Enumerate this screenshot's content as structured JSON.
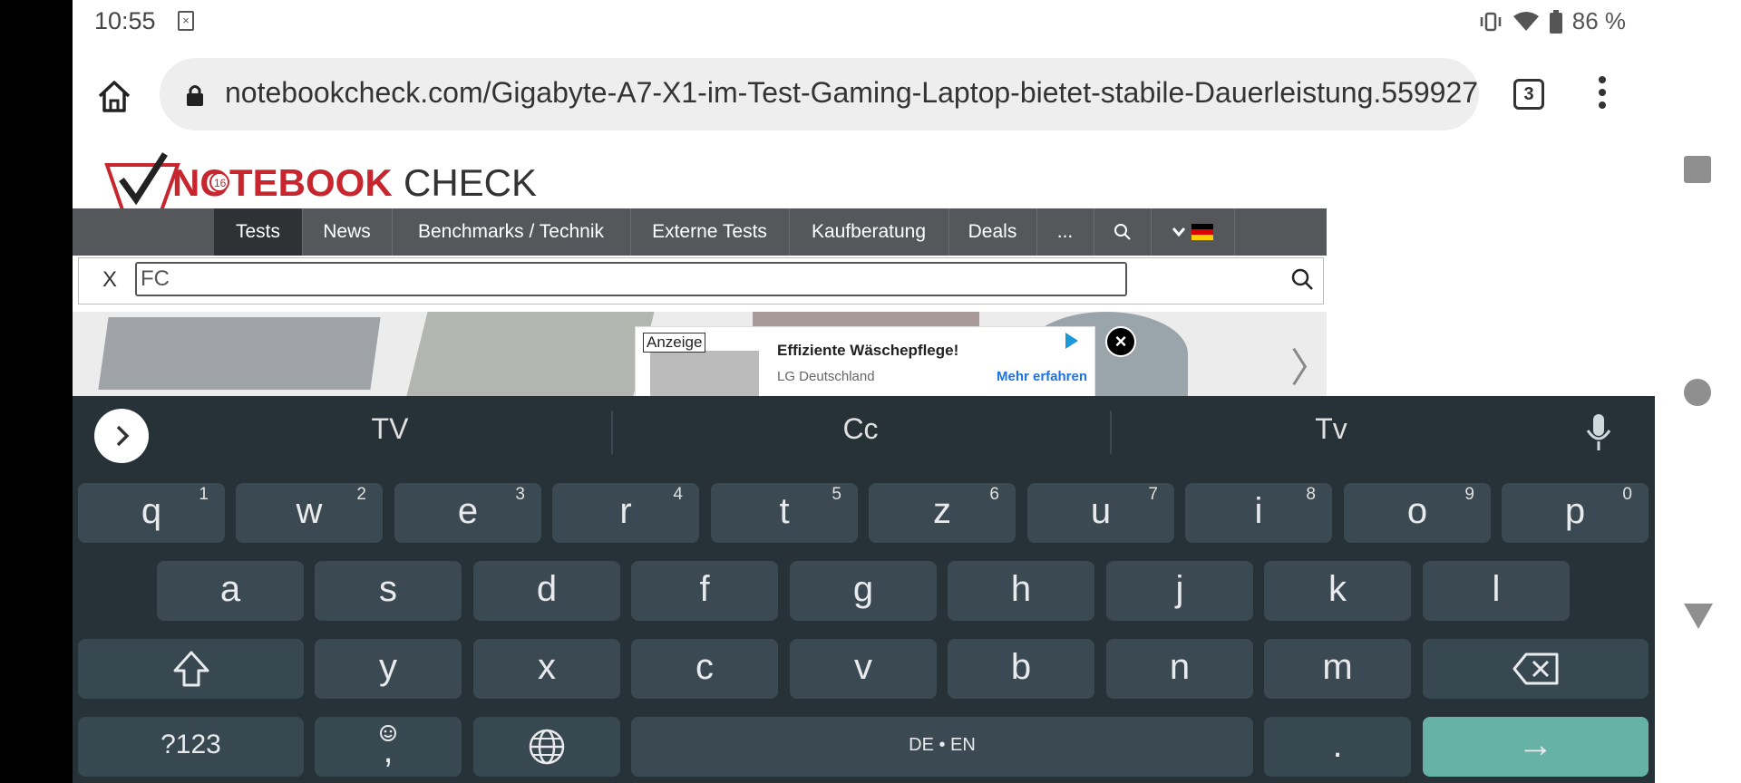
{
  "status_bar": {
    "time": "10:55",
    "battery": "86 %"
  },
  "browser": {
    "url": "notebookcheck.com/Gigabyte-A7-X1-im-Test-Gaming-Laptop-bietet-stabile-Dauerleistung.559927",
    "tab_count": "3"
  },
  "site": {
    "logo_text_red": "NOTEBOOK",
    "logo_text_dark": "CHECK",
    "logo_badge": "16",
    "nav": [
      "Tests",
      "News",
      "Benchmarks / Technik",
      "Externe Tests",
      "Kaufberatung",
      "Deals",
      "..."
    ],
    "search_close": "X",
    "search_value": "FC"
  },
  "ad": {
    "tag": "Anzeige",
    "title": "Effiziente Wäschepflege!",
    "advertiser": "LG Deutschland",
    "cta": "Mehr erfahren",
    "close": "×"
  },
  "keyboard": {
    "suggestions": [
      "TV",
      "Cc",
      "Tv"
    ],
    "row1": [
      {
        "k": "q",
        "n": "1"
      },
      {
        "k": "w",
        "n": "2"
      },
      {
        "k": "e",
        "n": "3"
      },
      {
        "k": "r",
        "n": "4"
      },
      {
        "k": "t",
        "n": "5"
      },
      {
        "k": "z",
        "n": "6"
      },
      {
        "k": "u",
        "n": "7"
      },
      {
        "k": "i",
        "n": "8"
      },
      {
        "k": "o",
        "n": "9"
      },
      {
        "k": "p",
        "n": "0"
      }
    ],
    "row2": [
      "a",
      "s",
      "d",
      "f",
      "g",
      "h",
      "j",
      "k",
      "l"
    ],
    "row3": [
      "y",
      "x",
      "c",
      "v",
      "b",
      "n",
      "m"
    ],
    "symbols_label": "?123",
    "comma_label": ",",
    "space_label": "DE • EN",
    "period_label": ".",
    "enter_label": "→"
  },
  "colors": {
    "keyboard_bg": "#263238",
    "key_bg": "#3b4a52",
    "enter_key": "#66b3a6",
    "brand_red": "#c8262e",
    "nav_bg": "#55575a"
  }
}
